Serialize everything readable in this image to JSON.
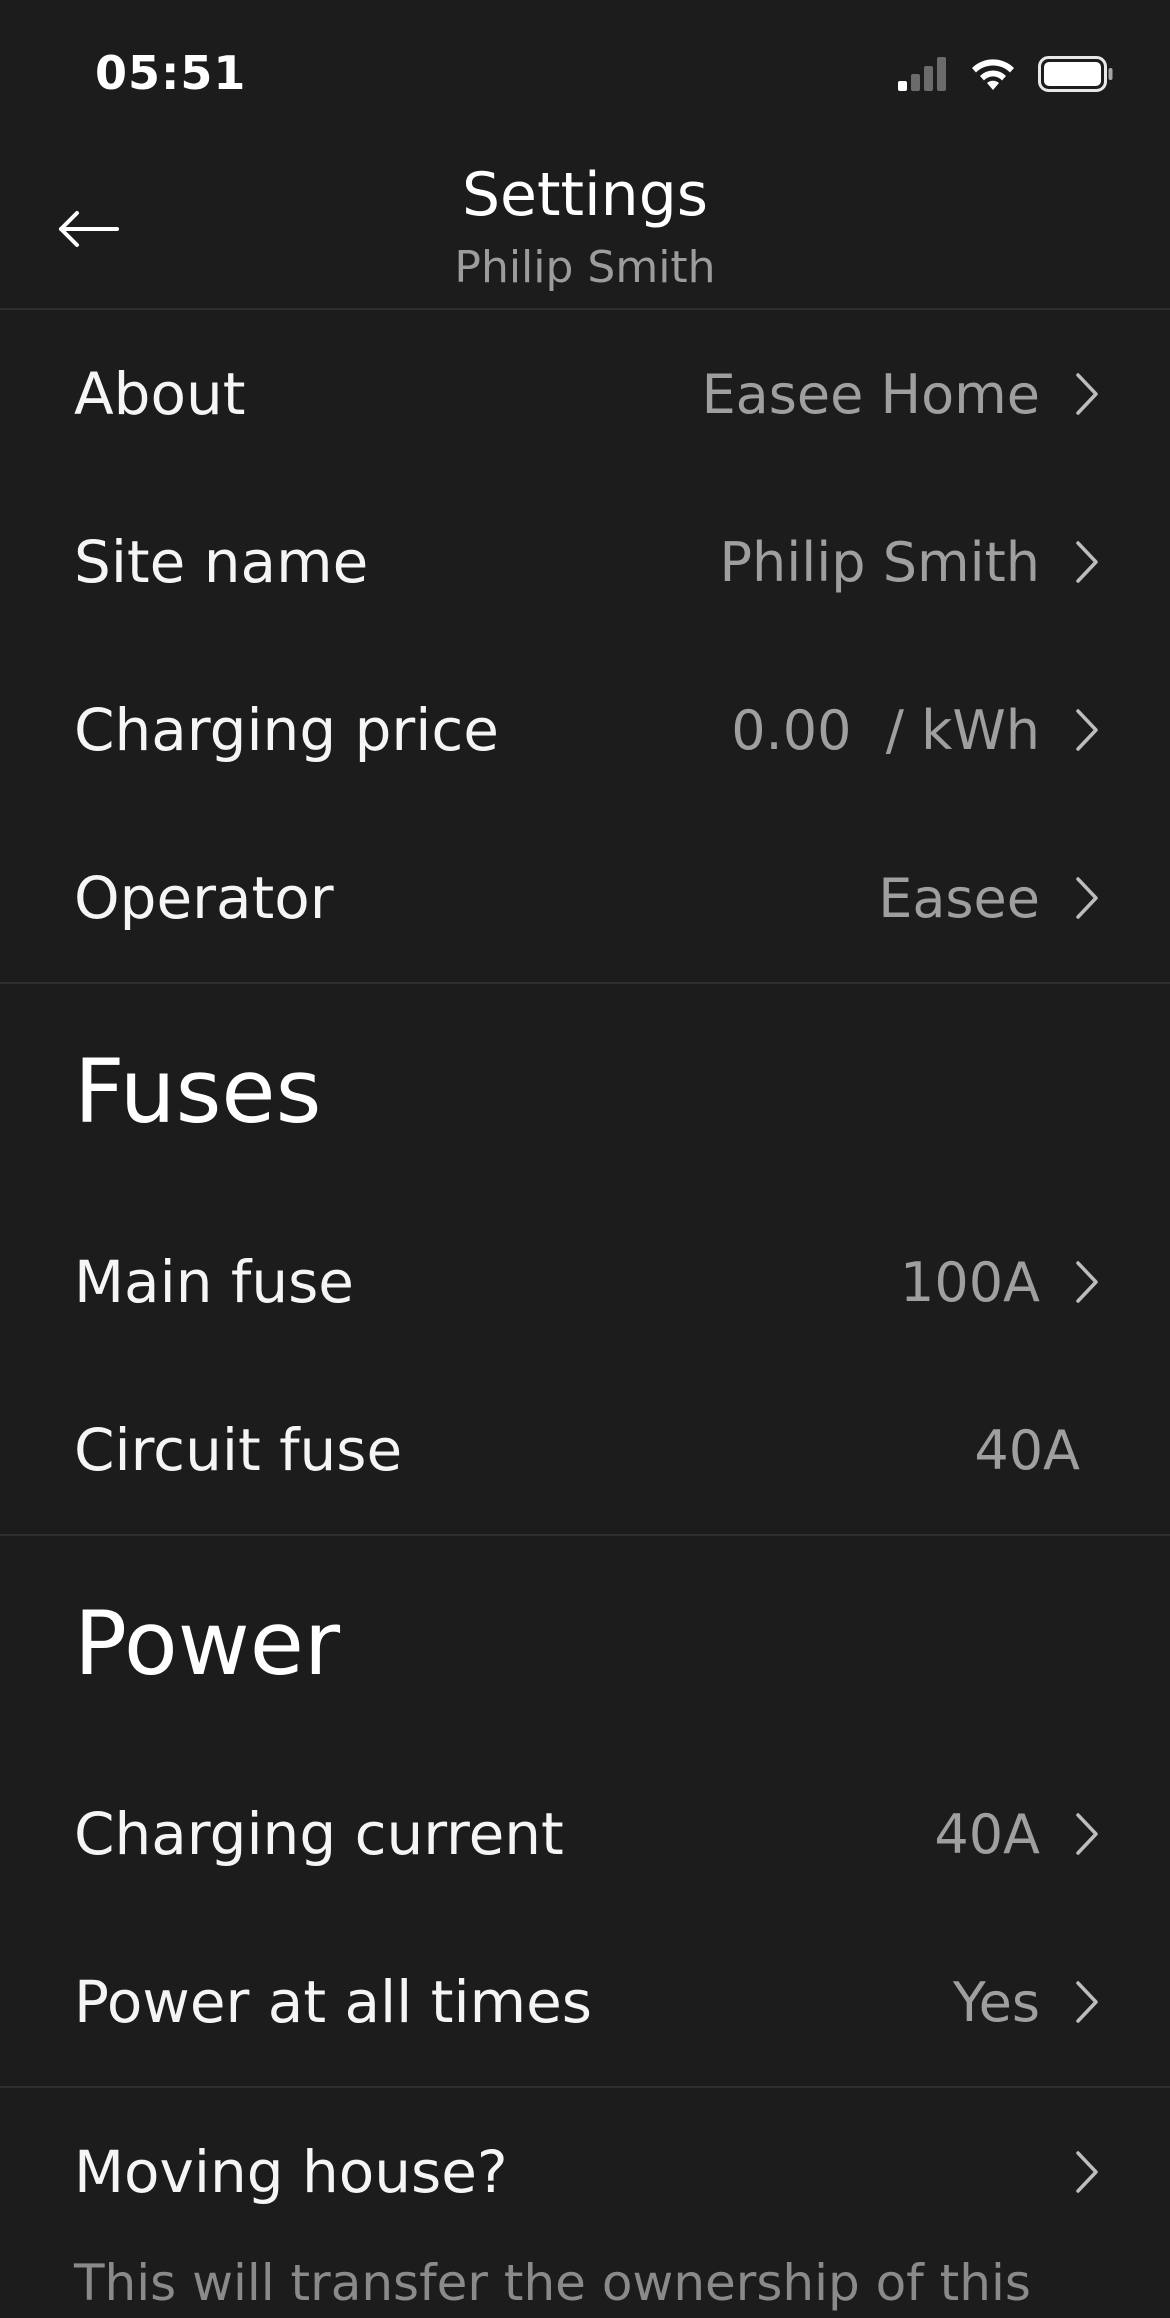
{
  "status_bar": {
    "time": "05:51"
  },
  "header": {
    "title": "Settings",
    "subtitle": "Philip Smith"
  },
  "general": [
    {
      "label": "About",
      "value": "Easee Home",
      "chevron": true
    },
    {
      "label": "Site name",
      "value": "Philip Smith",
      "chevron": true
    },
    {
      "label": "Charging price",
      "value": "0.00  / kWh",
      "chevron": true
    },
    {
      "label": "Operator",
      "value": "Easee",
      "chevron": true
    }
  ],
  "fuses": {
    "title": "Fuses",
    "items": [
      {
        "label": "Main fuse",
        "value": "100A",
        "chevron": true
      },
      {
        "label": "Circuit fuse",
        "value": "40A",
        "chevron": false
      }
    ]
  },
  "power": {
    "title": "Power",
    "items": [
      {
        "label": "Charging current",
        "value": "40A",
        "chevron": true
      },
      {
        "label": "Power at all times",
        "value": "Yes",
        "chevron": true
      }
    ]
  },
  "moving": {
    "label": "Moving house?",
    "description": "This will transfer the ownership of this"
  }
}
